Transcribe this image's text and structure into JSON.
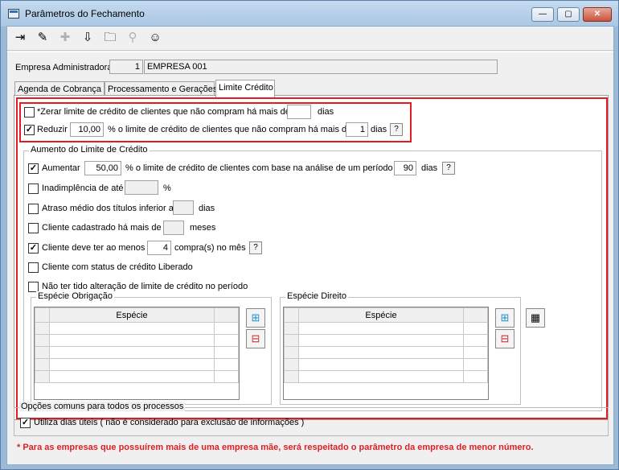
{
  "window": {
    "title": "Parâmetros do Fechamento",
    "min_glyph": "—",
    "max_glyph": "▢",
    "close_glyph": "✕"
  },
  "toolbar": {
    "items": [
      {
        "name": "exit-icon",
        "glyph": "⇥",
        "enabled": true
      },
      {
        "name": "eraser-icon",
        "glyph": "✎",
        "enabled": true
      },
      {
        "name": "add-icon",
        "glyph": "✚",
        "enabled": false
      },
      {
        "name": "download-icon",
        "glyph": "⇩",
        "enabled": true
      },
      {
        "name": "folder-icon",
        "glyph": "🗀",
        "enabled": true
      },
      {
        "name": "binoculars-icon",
        "glyph": "⚲",
        "enabled": false
      },
      {
        "name": "help-person-icon",
        "glyph": "☺",
        "enabled": true
      }
    ]
  },
  "empresa": {
    "label": "Empresa Administradora",
    "code": "1",
    "name": "EMPRESA 001"
  },
  "tabs": [
    {
      "label": "Agenda de Cobrança"
    },
    {
      "label": "Processamento e Gerações"
    },
    {
      "label": "Limite Crédito"
    }
  ],
  "zerar": {
    "checked": false,
    "label": "*Zerar limite de crédito de clientes que não compram há mais de",
    "value": "",
    "unit": "dias"
  },
  "reduzir": {
    "checked": true,
    "label": "Reduzir",
    "value": "10,00",
    "text": "% o limite de crédito de clientes que não compram há mais de",
    "days": "1",
    "unit": "dias",
    "help": "?"
  },
  "aumento": {
    "title": "Aumento do Limite de Crédito",
    "aumentar": {
      "checked": true,
      "label": "Aumentar",
      "value": "50,00",
      "text": "% o limite de crédito de clientes com base na análise de um período de",
      "days": "90",
      "unit": "dias",
      "help": "?"
    },
    "inadimplencia": {
      "checked": false,
      "label": "Inadimplência de até",
      "value": "",
      "unit": "%"
    },
    "atraso": {
      "checked": false,
      "label": "Atraso médio dos títulos inferior a",
      "value": "",
      "unit": "dias"
    },
    "cadastrado": {
      "checked": false,
      "label": "Cliente cadastrado há mais de",
      "value": "",
      "unit": "meses"
    },
    "compras": {
      "checked": true,
      "label": "Cliente deve ter ao menos",
      "value": "4",
      "unit": "compra(s) no mês",
      "help": "?"
    },
    "status": {
      "checked": false,
      "label": "Cliente com status de crédito Liberado"
    },
    "alteracao": {
      "checked": false,
      "label": "Não ter tido alteração de limite de crédito no período"
    }
  },
  "especie_obrigacao": {
    "title": "Espécie Obrigação",
    "column": "Espécie"
  },
  "especie_direito": {
    "title": "Espécie Direito",
    "column": "Espécie"
  },
  "opcoes": {
    "title": "Opções comuns para todos os processos",
    "checked": true,
    "label": "Utiliza dias úteis ( não é considerado para exclusão de informações )"
  },
  "note": "* Para as empresas que possuírem mais de uma empresa mãe, será respeitado o parâmetro da empresa de menor número."
}
